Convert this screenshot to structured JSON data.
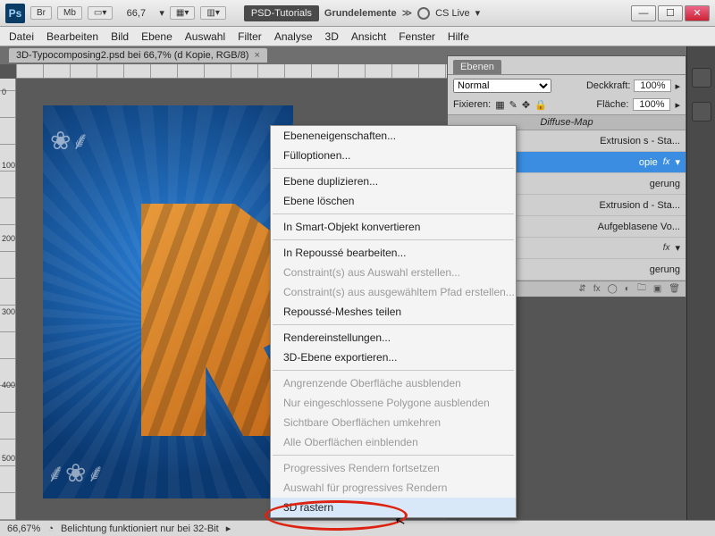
{
  "titlebar": {
    "zoom": "66,7",
    "psd_tutorials": "PSD-Tutorials",
    "grundelemente": "Grundelemente",
    "cs_live": "CS Live"
  },
  "menubar": [
    "Datei",
    "Bearbeiten",
    "Bild",
    "Ebene",
    "Auswahl",
    "Filter",
    "Analyse",
    "3D",
    "Ansicht",
    "Fenster",
    "Hilfe"
  ],
  "doc_tab": {
    "title": "3D-Typocomposing2.psd bei 66,7% (d Kopie, RGB/8)"
  },
  "ruler_ticks": [
    "0",
    "100",
    "200",
    "300",
    "400",
    "500"
  ],
  "panel": {
    "tab": "Ebenen",
    "blend": "Normal",
    "opacity_label": "Deckkraft:",
    "opacity_val": "100%",
    "fix_label": "Fixieren:",
    "fill_label": "Fläche:",
    "fill_val": "100%",
    "group_label": "Diffuse-Map",
    "layers": [
      {
        "name": "Extrusion s - Sta...",
        "fx": false,
        "sel": false
      },
      {
        "name": "opie",
        "fx": true,
        "sel": true
      },
      {
        "name": "gerung",
        "fx": false,
        "sel": false
      },
      {
        "name": "Extrusion d - Sta...",
        "fx": false,
        "sel": false
      },
      {
        "name": "Aufgeblasene Vo...",
        "fx": false,
        "sel": false
      },
      {
        "name": "",
        "fx": true,
        "sel": false
      },
      {
        "name": "gerung",
        "fx": false,
        "sel": false
      }
    ]
  },
  "context_menu": [
    {
      "label": "Ebeneneigenschaften...",
      "dis": false
    },
    {
      "label": "Fülloptionen...",
      "dis": false
    },
    {
      "sep": true
    },
    {
      "label": "Ebene duplizieren...",
      "dis": false
    },
    {
      "label": "Ebene löschen",
      "dis": false
    },
    {
      "sep": true
    },
    {
      "label": "In Smart-Objekt konvertieren",
      "dis": false
    },
    {
      "sep": true
    },
    {
      "label": "In Repoussé bearbeiten...",
      "dis": false
    },
    {
      "label": "Constraint(s) aus Auswahl erstellen...",
      "dis": true
    },
    {
      "label": "Constraint(s) aus ausgewähltem Pfad erstellen...",
      "dis": true
    },
    {
      "label": "Repoussé-Meshes teilen",
      "dis": false
    },
    {
      "sep": true
    },
    {
      "label": "Rendereinstellungen...",
      "dis": false
    },
    {
      "label": "3D-Ebene exportieren...",
      "dis": false
    },
    {
      "sep": true
    },
    {
      "label": "Angrenzende Oberfläche ausblenden",
      "dis": true
    },
    {
      "label": "Nur eingeschlossene Polygone ausblenden",
      "dis": true
    },
    {
      "label": "Sichtbare Oberflächen umkehren",
      "dis": true
    },
    {
      "label": "Alle Oberflächen einblenden",
      "dis": true
    },
    {
      "sep": true
    },
    {
      "label": "Progressives Rendern fortsetzen",
      "dis": true
    },
    {
      "label": "Auswahl für progressives Rendern",
      "dis": true
    },
    {
      "label": "3D rastern",
      "dis": false,
      "hl": true
    }
  ],
  "status": {
    "zoom": "66,67%",
    "exposure_msg": "Belichtung funktioniert nur bei 32-Bit"
  }
}
